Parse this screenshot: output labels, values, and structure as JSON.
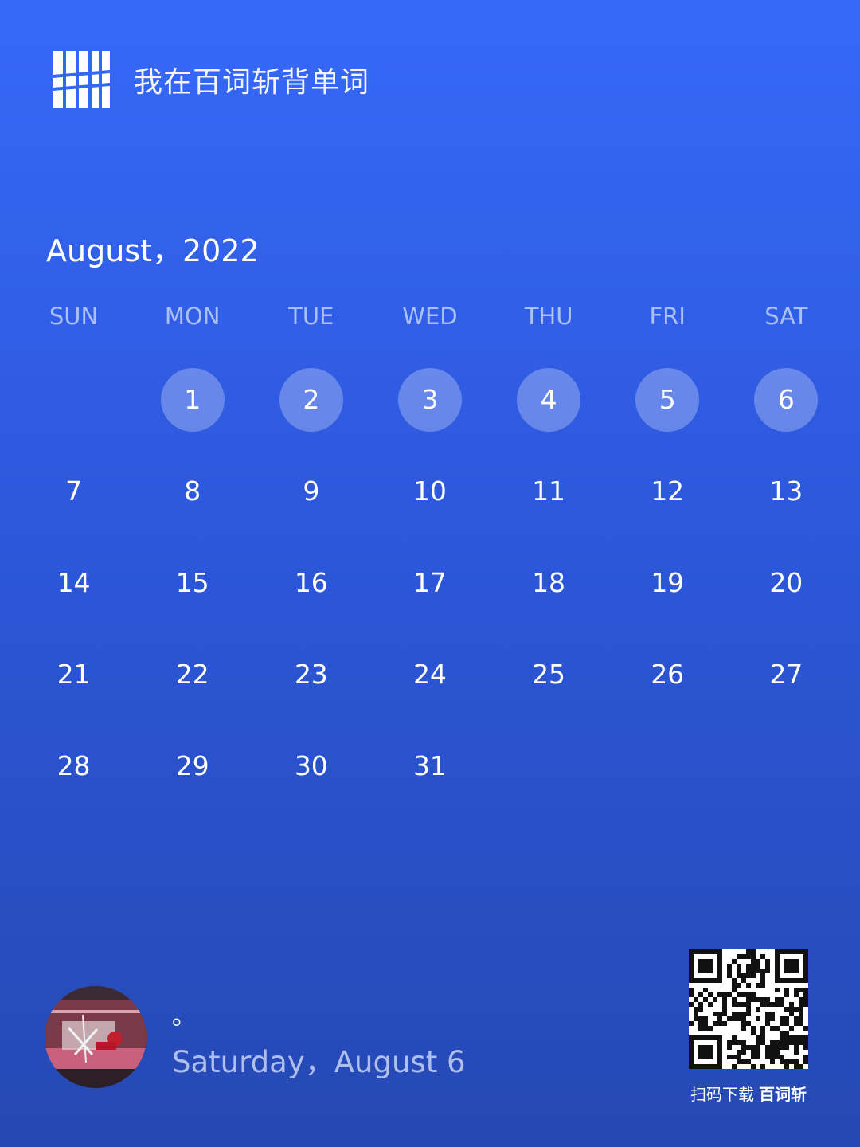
{
  "header": {
    "app_title": "我在百词斩背单词",
    "logo_icon": "baicizhan-logo-icon"
  },
  "calendar": {
    "month_title": "August，2022",
    "weekdays": [
      "SUN",
      "MON",
      "TUE",
      "WED",
      "THU",
      "FRI",
      "SAT"
    ],
    "first_weekday_index": 1,
    "days": [
      "1",
      "2",
      "3",
      "4",
      "5",
      "6",
      "7",
      "8",
      "9",
      "10",
      "11",
      "12",
      "13",
      "14",
      "15",
      "16",
      "17",
      "18",
      "19",
      "20",
      "21",
      "22",
      "23",
      "24",
      "25",
      "26",
      "27",
      "28",
      "29",
      "30",
      "31"
    ],
    "checked_days": [
      1,
      2,
      3,
      4,
      5,
      6
    ]
  },
  "footer": {
    "avatar_icon": "avatar-image",
    "mark": "。",
    "date": "Saturday，August 6"
  },
  "qr": {
    "icon": "qr-code-icon",
    "caption": "扫码下载",
    "brand": "百词斩"
  }
}
